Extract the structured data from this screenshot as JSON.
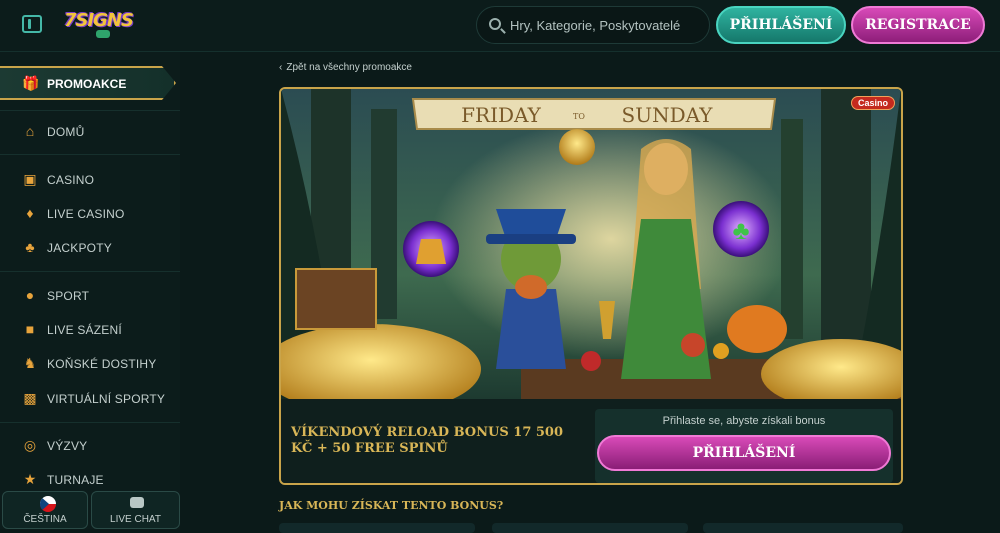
{
  "header": {
    "menu_toggle": "menu-toggle-icon",
    "logo_text": "7SIGNS",
    "search_placeholder": "Hry, Kategorie, Poskytovatelé",
    "login_label": "PŘIHLÁŠENÍ",
    "register_label": "REGISTRACE"
  },
  "sidebar": {
    "active": {
      "label": "PROMOAKCE",
      "icon": "gift-icon"
    },
    "items": [
      {
        "label": "DOMŮ",
        "icon": "home-icon"
      },
      {
        "label": "CASINO",
        "icon": "slot-machine-icon"
      },
      {
        "label": "LIVE CASINO",
        "icon": "card-icon"
      },
      {
        "label": "JACKPOTY",
        "icon": "clover-icon"
      },
      {
        "label": "SPORT",
        "icon": "basketball-icon"
      },
      {
        "label": "LIVE SÁZENÍ",
        "icon": "live-icon"
      },
      {
        "label": "KOŇSKÉ DOSTIHY",
        "icon": "horse-icon"
      },
      {
        "label": "VIRTUÁLNÍ SPORTY",
        "icon": "vr-icon"
      },
      {
        "label": "VÝZVY",
        "icon": "target-icon"
      },
      {
        "label": "TURNAJE",
        "icon": "trophy-icon"
      }
    ],
    "language_label": "ČEŠTINA",
    "chat_label": "LIVE CHAT"
  },
  "main": {
    "back_label": "Zpět na všechny promoakce",
    "banner_text": {
      "left": "FRIDAY",
      "mid": "TO",
      "right": "SUNDAY"
    },
    "badge": "Casino",
    "promo_title": "VÍKENDOVÝ RELOAD BONUS 17 500 KČ + 50 FREE SPINŮ",
    "login_hint": "Přihlaste se, abyste získali bonus",
    "login_button": "PŘIHLÁŠENÍ",
    "howto_title": "JAK MOHU ZÍSKAT TENTO BONUS?"
  },
  "colors": {
    "bg": "#0b1a19",
    "accent_teal": "#2fb3a0",
    "accent_pink": "#d84ab8",
    "gold": "#c9a44a"
  }
}
